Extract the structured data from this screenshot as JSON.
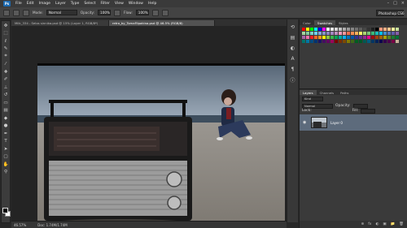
{
  "menu": {
    "logo": "Ps",
    "items": [
      "File",
      "Edit",
      "Image",
      "Layer",
      "Type",
      "Select",
      "Filter",
      "View",
      "Window",
      "Help"
    ],
    "controls": [
      "–",
      "□",
      "×"
    ]
  },
  "options": {
    "mode_label": "Mode:",
    "mode_value": "Normal",
    "opacity_label": "Opacity:",
    "opacity_value": "100%",
    "flow_label": "Flow:",
    "flow_value": "100%",
    "workspace": "Photoshop CS6"
  },
  "tabs": [
    {
      "label": "Milk_334 - Selos sinnika.psd @ 15% (Layer 1, RGB/8*)",
      "active": false
    },
    {
      "label": "retro_by_TomaFilpakina.psd @ 46.5% (RGB/8)",
      "active": true
    }
  ],
  "status": {
    "zoom": "46.57%",
    "doc": "Doc: 1.74M/1.74M"
  },
  "right_panel": {
    "top_tabs": [
      "Color",
      "Swatches",
      "Styles"
    ],
    "layer_tabs": [
      "Layers",
      "Channels",
      "Paths"
    ],
    "kind_label": "Kind",
    "blend_mode": "Normal",
    "opacity_label": "Opacity:",
    "lock_label": "Lock:",
    "fill_label": "Fill:",
    "layer_name": "Layer 0",
    "footer_icons": [
      "⊕",
      "fx",
      "◐",
      "▣",
      "📁",
      "🗑"
    ]
  },
  "colors": {
    "accent": "#1d6ab0",
    "selected_layer": "#5d6b7c",
    "swatches": [
      "#ff0000",
      "#ffff00",
      "#00ff00",
      "#00ffff",
      "#0000ff",
      "#ff00ff",
      "#ffffff",
      "#ebebeb",
      "#d6d6d6",
      "#c2c2c2",
      "#adadad",
      "#999999",
      "#858585",
      "#707070",
      "#5c5c5c",
      "#474747",
      "#333333",
      "#1f1f1f",
      "#000000",
      "#f7977a",
      "#fbad82",
      "#fdc68c",
      "#fff799",
      "#c6df9c",
      "#a4d49d",
      "#81ca9d",
      "#7bcdc8",
      "#6ecff6",
      "#7ea7d8",
      "#8493ca",
      "#8882be",
      "#a187be",
      "#bc8dbf",
      "#f49bc1",
      "#f5989d",
      "#f16c4d",
      "#f68e54",
      "#fbaf5a",
      "#fff467",
      "#acd372",
      "#7cc576",
      "#3bb878",
      "#1abbb4",
      "#00bff3",
      "#438ccb",
      "#5574b9",
      "#605ca9",
      "#855fa8",
      "#a763a9",
      "#ef6ea8",
      "#ed1c24",
      "#f26522",
      "#f7941d",
      "#fff200",
      "#8dc63f",
      "#39b54a",
      "#00a651",
      "#00a99d",
      "#00aeef",
      "#0072bc",
      "#0054a5",
      "#2e3192",
      "#662d91",
      "#92278f",
      "#ec008c",
      "#9e0b0f",
      "#a0410d",
      "#a3620a",
      "#aba000",
      "#598527",
      "#1a7b30",
      "#007236",
      "#00746b",
      "#0076a4",
      "#004b80",
      "#003370",
      "#1b1464",
      "#440e62",
      "#630460",
      "#9b005c",
      "#790000",
      "#7b2e00",
      "#7d4900",
      "#827a00",
      "#406618",
      "#005e20",
      "#005826",
      "#005952",
      "#005b7f",
      "#003663",
      "#002157",
      "#0d004c",
      "#32004b",
      "#4b0049",
      "#7a0045",
      "#c7b299"
    ]
  }
}
